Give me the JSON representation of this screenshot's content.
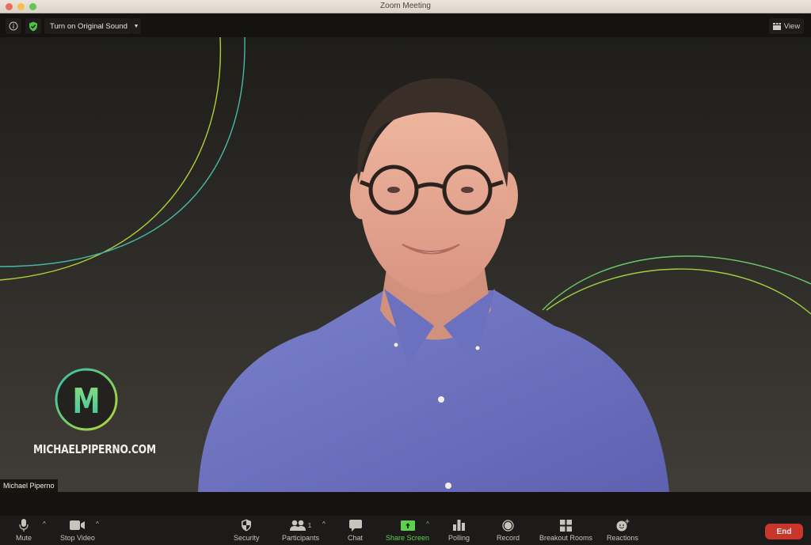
{
  "window": {
    "title": "Zoom Meeting"
  },
  "topbar": {
    "info_icon": "info-icon",
    "security_shield_icon": "shield-check-icon",
    "original_sound_label": "Turn on Original Sound",
    "view_label": "View"
  },
  "video": {
    "participant_name": "Michael Piperno",
    "logo_letter": "M",
    "logo_text": "MICHAELPIPERNO.COM",
    "accent_colors": {
      "teal": "#3fc1b5",
      "lime": "#b5d334"
    }
  },
  "toolbar": {
    "mute_label": "Mute",
    "stop_video_label": "Stop Video",
    "security_label": "Security",
    "participants_label": "Participants",
    "participants_count": "1",
    "chat_label": "Chat",
    "share_screen_label": "Share Screen",
    "polling_label": "Polling",
    "record_label": "Record",
    "breakout_label": "Breakout Rooms",
    "reactions_label": "Reactions",
    "end_label": "End",
    "caret": "^",
    "share_color": "#5fd04e",
    "end_color": "#c7352b"
  }
}
